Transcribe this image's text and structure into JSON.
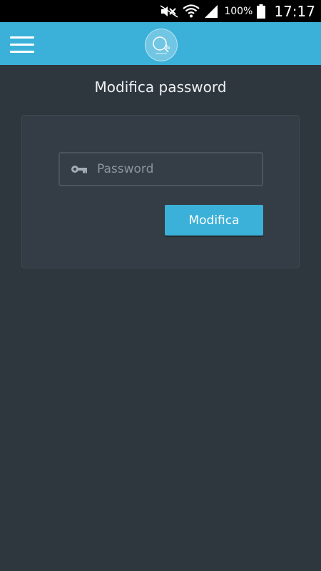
{
  "status_bar": {
    "battery_percent": "100%",
    "time": "17:17",
    "icons": [
      "mute-icon",
      "wifi-icon",
      "signal-icon",
      "battery-icon"
    ]
  },
  "app_bar": {
    "background_color": "#3bb1d9",
    "menu_icon": "hamburger-menu-icon",
    "logo_icon": "app-logo-icon"
  },
  "page": {
    "title": "Modifica password"
  },
  "form": {
    "password_placeholder": "Password",
    "password_value": "",
    "password_icon": "key-icon",
    "submit_label": "Modifica"
  },
  "colors": {
    "accent": "#3bb1d9",
    "background": "#2e363e",
    "card": "#343c45"
  }
}
